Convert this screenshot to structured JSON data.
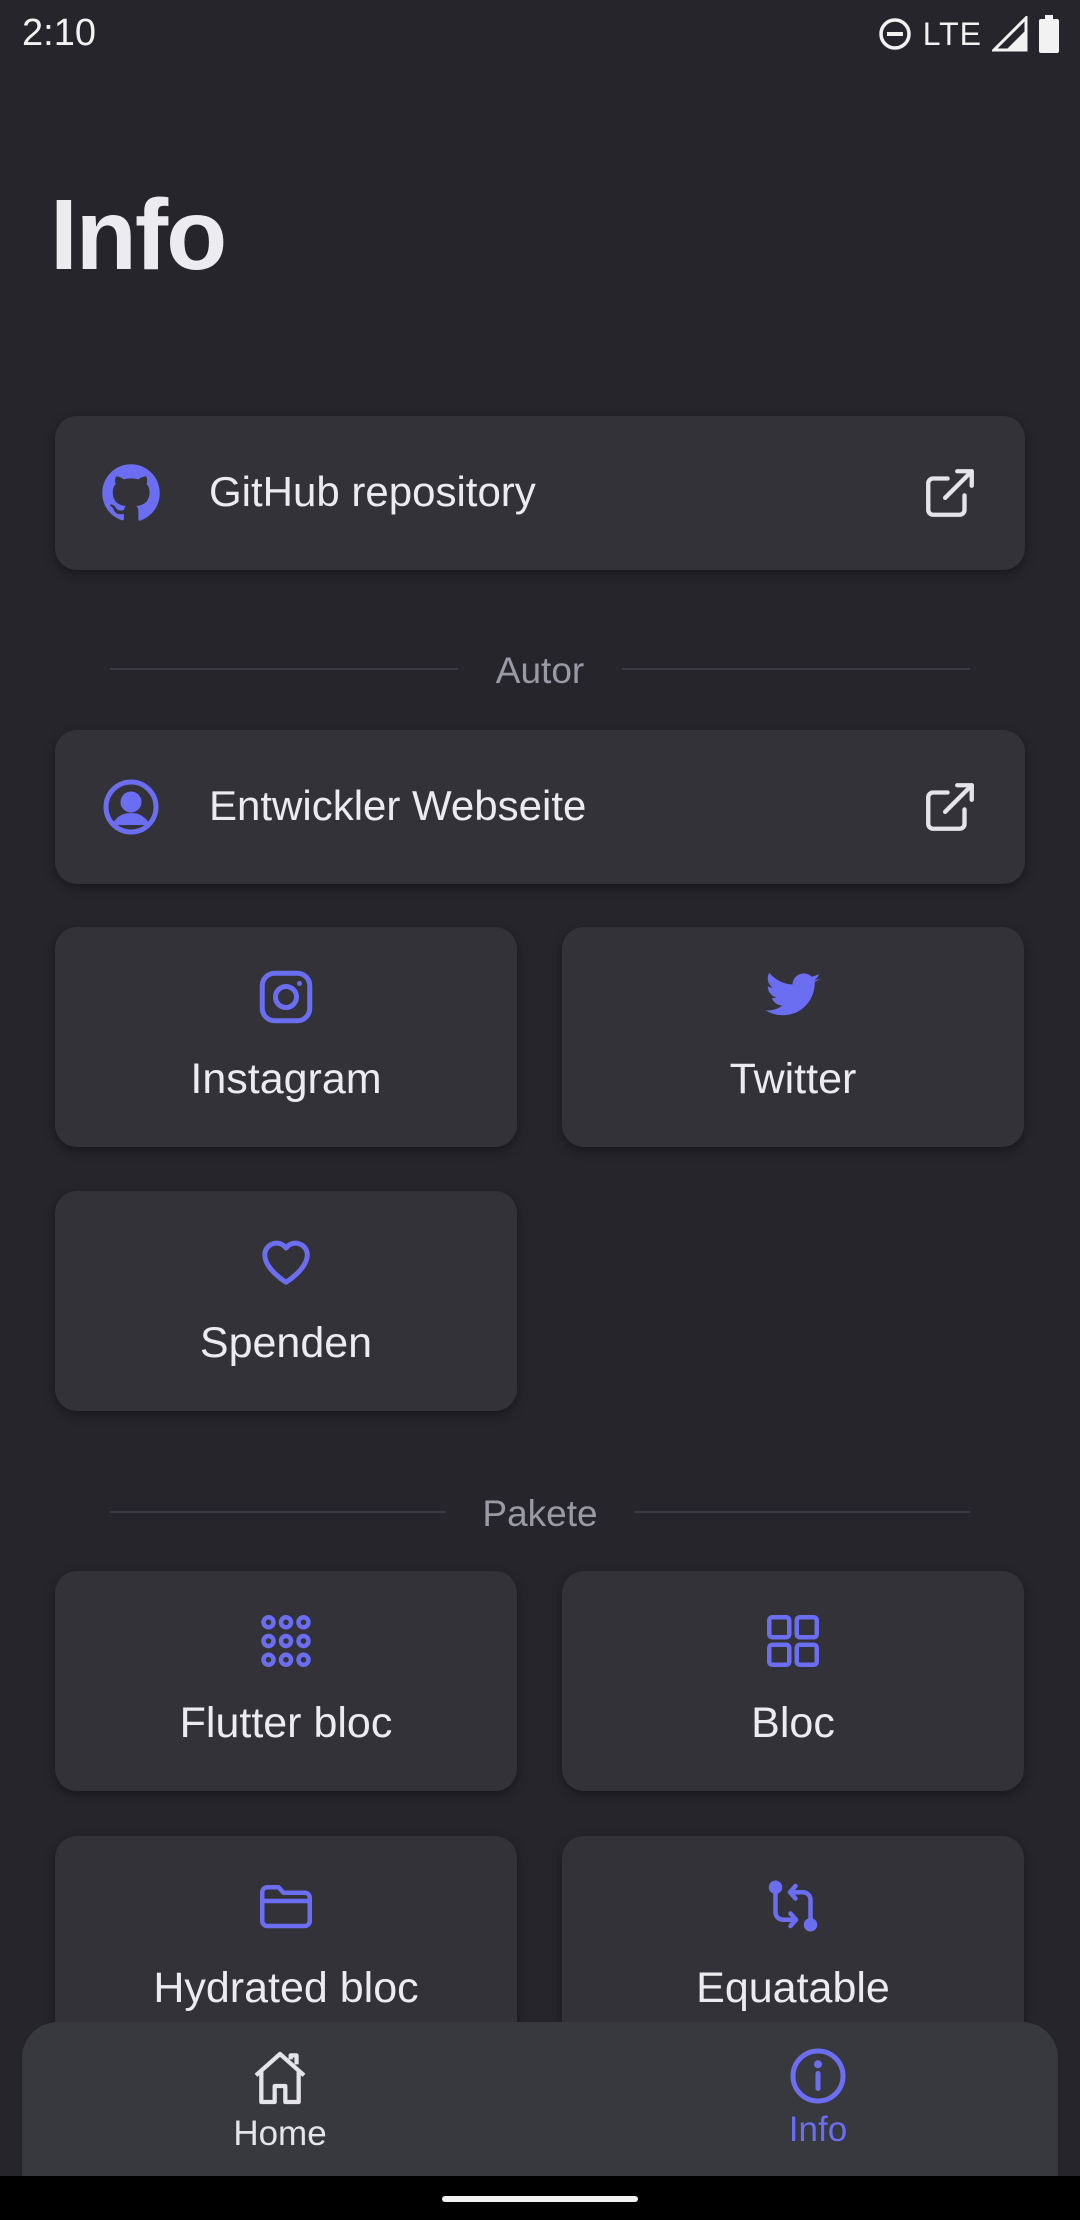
{
  "status_bar": {
    "time": "2:10",
    "network": "LTE"
  },
  "page": {
    "title": "Info"
  },
  "links": {
    "github": {
      "label": "GitHub repository",
      "icon": "github-icon"
    },
    "developer": {
      "label": "Entwickler Webseite",
      "icon": "user-circle-icon"
    }
  },
  "sections": {
    "author": {
      "label": "Autor"
    },
    "packages": {
      "label": "Pakete"
    }
  },
  "author_tiles": [
    {
      "label": "Instagram",
      "icon": "instagram-icon"
    },
    {
      "label": "Twitter",
      "icon": "twitter-icon"
    },
    {
      "label": "Spenden",
      "icon": "heart-icon"
    }
  ],
  "package_tiles": [
    {
      "label": "Flutter bloc",
      "icon": "dots-grid-icon"
    },
    {
      "label": "Bloc",
      "icon": "squares-grid-icon"
    },
    {
      "label": "Hydrated bloc",
      "icon": "folder-icon"
    },
    {
      "label": "Equatable",
      "icon": "compare-icon"
    }
  ],
  "bottom_nav": {
    "items": [
      {
        "label": "Home",
        "icon": "home-icon",
        "active": false
      },
      {
        "label": "Info",
        "icon": "info-icon",
        "active": true
      }
    ]
  },
  "colors": {
    "background": "#25252b",
    "card": "#323238",
    "accent": "#6b6ef0",
    "text": "#ececf0",
    "muted": "#9a9aa4"
  }
}
